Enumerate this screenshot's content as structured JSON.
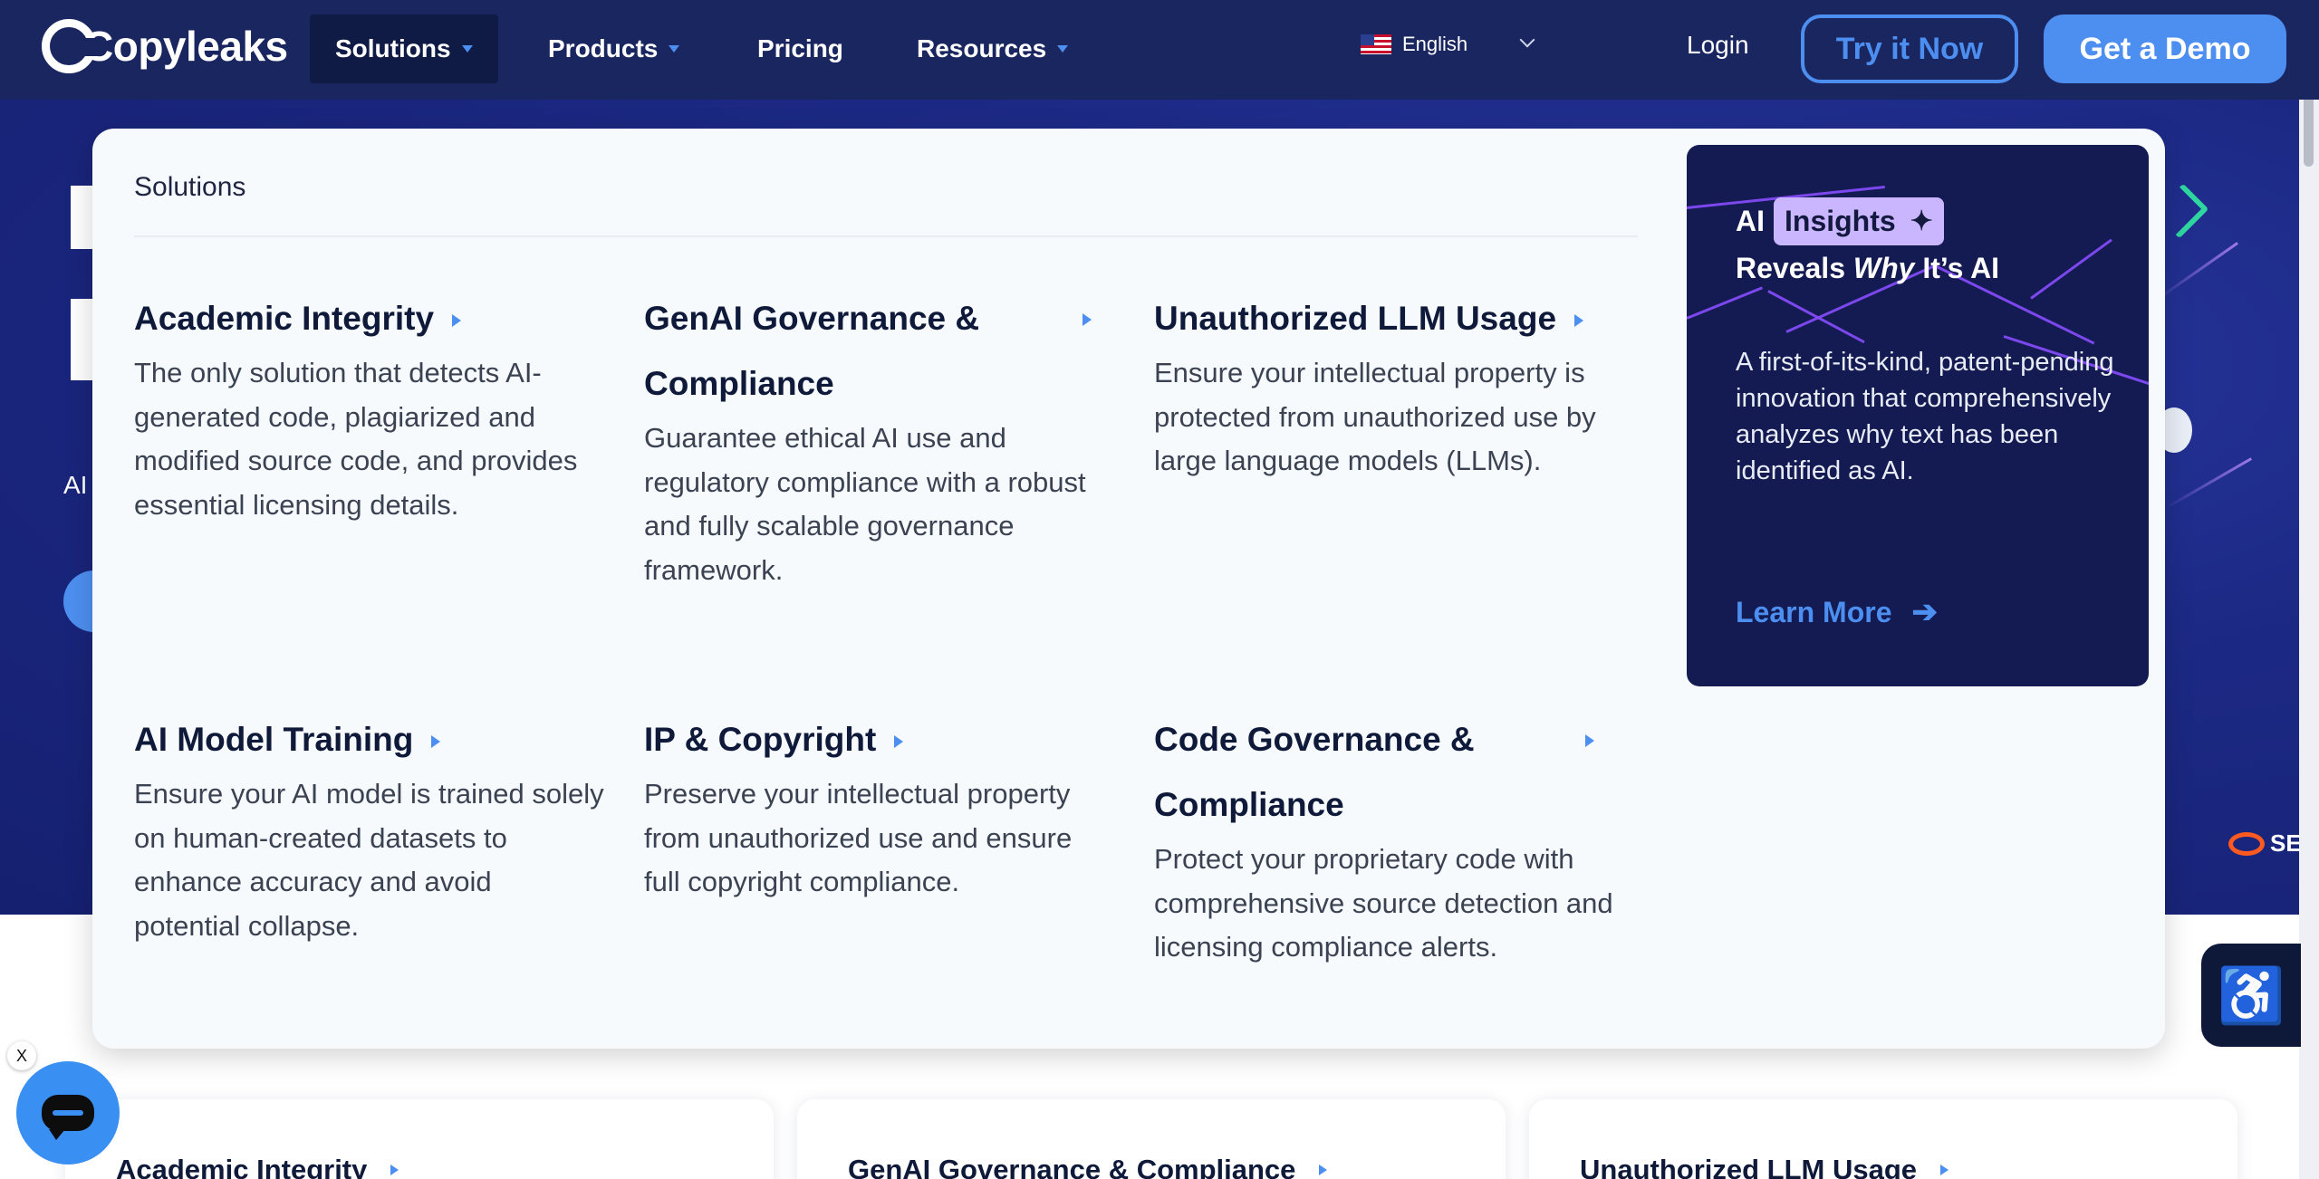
{
  "header": {
    "logo_text": "Copyleaks",
    "nav": {
      "solutions": "Solutions",
      "products": "Products",
      "pricing": "Pricing",
      "resources": "Resources"
    },
    "language": "English",
    "login": "Login",
    "try_now": "Try it Now",
    "get_demo": "Get a Demo"
  },
  "hero": {
    "ai_text": "AI",
    "partner_text": "SE"
  },
  "mega_menu": {
    "title": "Solutions",
    "items": [
      {
        "title": "Academic Integrity",
        "desc": "The only solution that detects AI-generated code, plagiarized and modified source code, and provides essential licensing details."
      },
      {
        "title": "GenAI Governance & Compliance",
        "desc": "Guarantee ethical AI use and regulatory compliance with a robust and fully scalable governance framework."
      },
      {
        "title": "Unauthorized LLM Usage",
        "desc": "Ensure your intellectual property is protected from unauthorized use by large language models (LLMs)."
      },
      {
        "title": "AI Model Training",
        "desc": "Ensure your AI model is trained solely on human-created datasets to enhance accuracy and avoid potential collapse."
      },
      {
        "title": "IP & Copyright",
        "desc": "Preserve your intellectual property from unauthorized use and ensure full copyright compliance."
      },
      {
        "title": "Code Governance & Compliance",
        "desc": "Protect your proprietary code with comprehensive source detection and licensing compliance alerts."
      }
    ],
    "promo": {
      "title_ai": "AI",
      "title_pill": "Insights",
      "title_line2_a": "Reveals",
      "title_line2_why": "Why",
      "title_line2_b": "It’s AI",
      "desc": "A first-of-its-kind, patent-pending innovation that comprehensively analyzes why text has been identified as AI.",
      "link": "Learn More"
    }
  },
  "bottom_cards": [
    {
      "title": "Academic Integrity"
    },
    {
      "title": "GenAI Governance & Compliance"
    },
    {
      "title": "Unauthorized LLM Usage"
    }
  ],
  "widgets": {
    "chat_close": "X"
  },
  "colors": {
    "header_bg": "#1a2660",
    "accent": "#4d8ff0",
    "promo_bg": "#131b52",
    "pill": "#c9b6ff"
  },
  "icons": [
    "caret-down-icon",
    "flag-us-icon",
    "chevron-down-icon",
    "sparkle-icon",
    "arrow-right-icon",
    "chat-icon",
    "accessibility-icon"
  ]
}
